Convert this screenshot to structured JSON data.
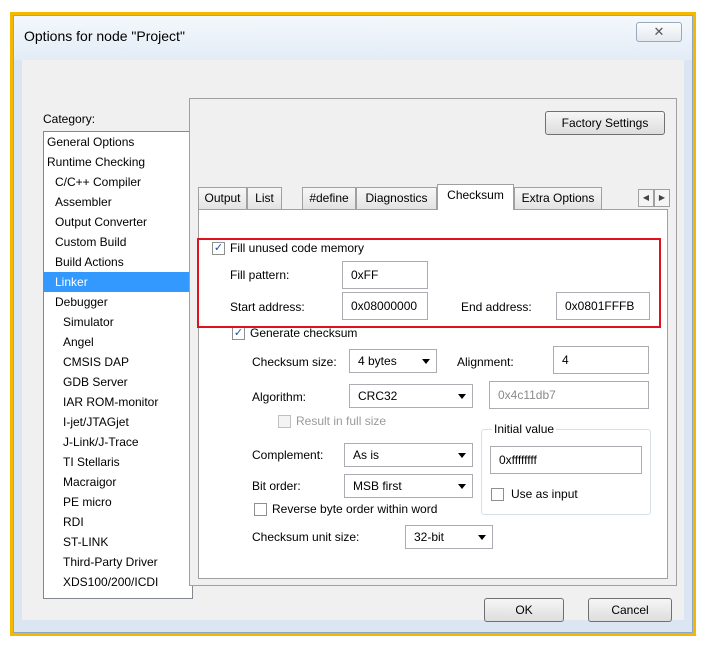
{
  "window": {
    "title": "Options for node \"Project\"",
    "close_icon": "close-icon"
  },
  "category": {
    "label": "Category:",
    "items": [
      {
        "label": "General Options",
        "level": 0
      },
      {
        "label": "Runtime Checking",
        "level": 0
      },
      {
        "label": "C/C++ Compiler",
        "level": 1
      },
      {
        "label": "Assembler",
        "level": 1
      },
      {
        "label": "Output Converter",
        "level": 1
      },
      {
        "label": "Custom Build",
        "level": 1
      },
      {
        "label": "Build Actions",
        "level": 1
      },
      {
        "label": "Linker",
        "level": 1,
        "selected": true
      },
      {
        "label": "Debugger",
        "level": 1
      },
      {
        "label": "Simulator",
        "level": 2
      },
      {
        "label": "Angel",
        "level": 2
      },
      {
        "label": "CMSIS DAP",
        "level": 2
      },
      {
        "label": "GDB Server",
        "level": 2
      },
      {
        "label": "IAR ROM-monitor",
        "level": 2
      },
      {
        "label": "I-jet/JTAGjet",
        "level": 2
      },
      {
        "label": "J-Link/J-Trace",
        "level": 2
      },
      {
        "label": "TI Stellaris",
        "level": 2
      },
      {
        "label": "Macraigor",
        "level": 2
      },
      {
        "label": "PE micro",
        "level": 2
      },
      {
        "label": "RDI",
        "level": 2
      },
      {
        "label": "ST-LINK",
        "level": 2
      },
      {
        "label": "Third-Party Driver",
        "level": 2
      },
      {
        "label": "XDS100/200/ICDI",
        "level": 2
      }
    ]
  },
  "factory_settings_label": "Factory Settings",
  "tabs": [
    {
      "label": "Output"
    },
    {
      "label": "List"
    },
    {
      "label": "#define"
    },
    {
      "label": "Diagnostics"
    },
    {
      "label": "Checksum",
      "active": true
    },
    {
      "label": "Extra Options"
    }
  ],
  "checksum": {
    "fill_unused_label": "Fill unused code memory",
    "fill_unused_checked": true,
    "fill_pattern_label": "Fill pattern:",
    "fill_pattern_value": "0xFF",
    "start_address_label": "Start address:",
    "start_address_value": "0x08000000",
    "end_address_label": "End address:",
    "end_address_value": "0x0801FFFB",
    "generate_label": "Generate checksum",
    "generate_checked": true,
    "checksum_size_label": "Checksum size:",
    "checksum_size_value": "4 bytes",
    "alignment_label": "Alignment:",
    "alignment_value": "4",
    "algorithm_label": "Algorithm:",
    "algorithm_value": "CRC32",
    "polynomial_value": "0x4c11db7",
    "result_full_label": "Result in full size",
    "initial_value_title": "Initial value",
    "initial_value": "0xffffffff",
    "use_as_input_label": "Use as input",
    "complement_label": "Complement:",
    "complement_value": "As is",
    "bit_order_label": "Bit order:",
    "bit_order_value": "MSB first",
    "reverse_label": "Reverse byte order within word",
    "unit_size_label": "Checksum unit size:",
    "unit_size_value": "32-bit"
  },
  "buttons": {
    "ok": "OK",
    "cancel": "Cancel"
  },
  "colors": {
    "highlight_box": "#e0101e",
    "selection": "#3399ff",
    "screenshot_frame": "#f5b800"
  }
}
